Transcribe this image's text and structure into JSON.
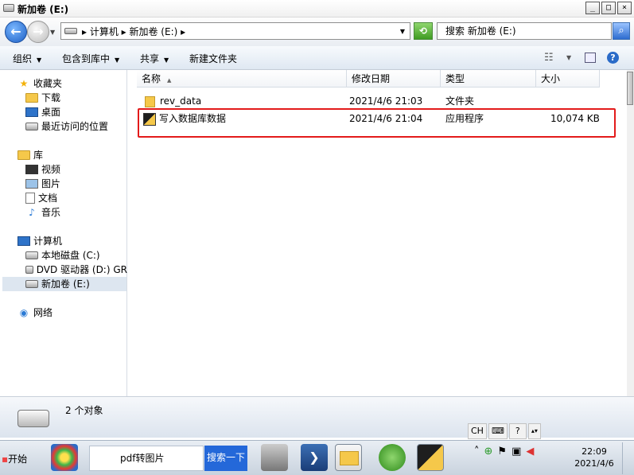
{
  "window": {
    "title": "新加卷 (E:)"
  },
  "address": {
    "path": "▸ 计算机 ▸ 新加卷 (E:) ▸",
    "search_placeholder": "搜索 新加卷 (E:)"
  },
  "toolbar": {
    "items": [
      "组织",
      "包含到库中",
      "共享",
      "新建文件夹"
    ]
  },
  "sidebar": {
    "favorites": "收藏夹",
    "downloads": "下载",
    "desktop": "桌面",
    "recent": "最近访问的位置",
    "libraries": "库",
    "video": "视频",
    "pictures": "图片",
    "documents": "文档",
    "music": "音乐",
    "computer": "计算机",
    "local_disk": "本地磁盘 (C:)",
    "dvd": "DVD 驱动器 (D:) GR",
    "new_volume": "新加卷 (E:)",
    "network": "网络"
  },
  "columns": [
    "名称",
    "修改日期",
    "类型",
    "大小"
  ],
  "files": [
    {
      "name": "rev_data",
      "date": "2021/4/6 21:03",
      "type": "文件夹",
      "size": ""
    },
    {
      "name": "写入数据库数据",
      "date": "2021/4/6 21:04",
      "type": "应用程序",
      "size": "10,074 KB"
    }
  ],
  "status": {
    "count": "2 个对象"
  },
  "langbar": {
    "lang": "CH"
  },
  "taskbar": {
    "start": "开始",
    "ie_text": "pdf转图片",
    "search_go": "搜索一下",
    "time": "22:09",
    "date": "2021/4/6"
  },
  "colors": {
    "highlight": "#e31b1b",
    "selection": "#dde6f0"
  }
}
